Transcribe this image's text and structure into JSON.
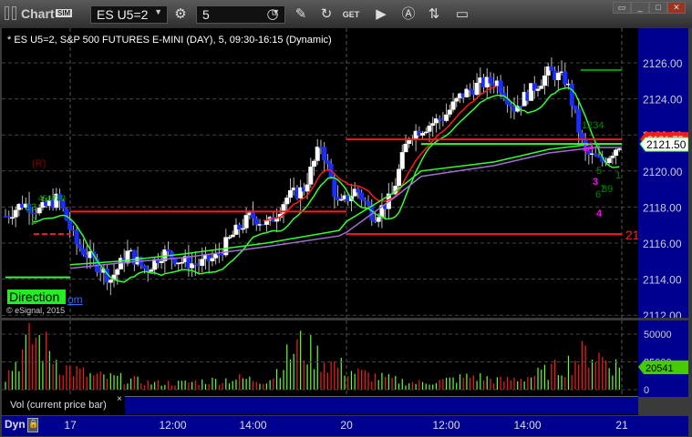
{
  "window": {
    "title": "Chart",
    "sim_badge": "SIM"
  },
  "toolbar": {
    "symbol": "ES U5=2",
    "interval": "5",
    "get_label": "GET"
  },
  "chart_header": "* ES U5=2, S&P 500 FUTURES E-MINI (DAY), 5, 09:30-16:15 (Dynamic)",
  "annotations": {
    "r_label": "(R)",
    "direction": "Direction",
    "link_fragment": "om",
    "copyright": "© eSignal, 2015",
    "level_label": "21",
    "counts_left": [
      "13",
      "2",
      "456789"
    ],
    "counts_right_green": [
      "1234",
      "5",
      "7",
      "6",
      "89",
      "1"
    ],
    "counts_right_magenta": [
      "1",
      "2",
      "3",
      "4"
    ]
  },
  "price_labels": {
    "last": "2121.50",
    "red": "2121.75"
  },
  "volume": {
    "label": "Vol (current price bar)",
    "last": "20541",
    "ticks": [
      "50000",
      "25000",
      "0"
    ]
  },
  "bottom": {
    "dyn": "Dyn",
    "time_ticks": [
      "17",
      "12:00",
      "14:00",
      "20",
      "12:00",
      "14:00",
      "21"
    ]
  },
  "chart_data": {
    "type": "candlestick",
    "ylim": [
      2112,
      2127
    ],
    "y_ticks": [
      "2126.00",
      "2124.00",
      "2122.00",
      "2120.00",
      "2118.00",
      "2116.00",
      "2114.00",
      "2112.00"
    ],
    "close_keypoints": [
      2117.5,
      2118.2,
      2117.8,
      2118.5,
      2116,
      2115,
      2114,
      2115.5,
      2114.5,
      2115.5,
      2115,
      2114.8,
      2115.2,
      2116.5,
      2117.5,
      2117,
      2118.5,
      2119,
      2121.5,
      2118,
      2119,
      2117.5,
      2118.5,
      2122,
      2122.5,
      2123,
      2124.2,
      2124.8,
      2125,
      2123.5,
      2124.5,
      2125.5,
      2125,
      2121,
      2120.5,
      2121.5
    ],
    "volume_keypoints": [
      12000,
      48000,
      20000,
      12000,
      10000,
      6000,
      6000,
      8000,
      10000,
      8000,
      40000,
      25000,
      15000,
      10000,
      6000,
      8000,
      12000,
      8000,
      12000,
      20000,
      34000,
      20000
    ],
    "levels": [
      {
        "price": 2117.75,
        "color": "#ff1a1a"
      },
      {
        "price": 2121.75,
        "color": "#ff1a1a"
      },
      {
        "price": 2116.5,
        "color": "#ff1a1a"
      },
      {
        "price": 2125.6,
        "color": "#00a000"
      },
      {
        "price": 2121.5,
        "color": "#33ff33"
      }
    ],
    "colors": {
      "up": "#ffffff",
      "down": "#1a2cff",
      "ma": "#33ff33",
      "vwap": "#a070d0",
      "ema": "#ff1a1a",
      "vol_up": "#66ff33",
      "vol_down": "#ff1a1a"
    }
  }
}
